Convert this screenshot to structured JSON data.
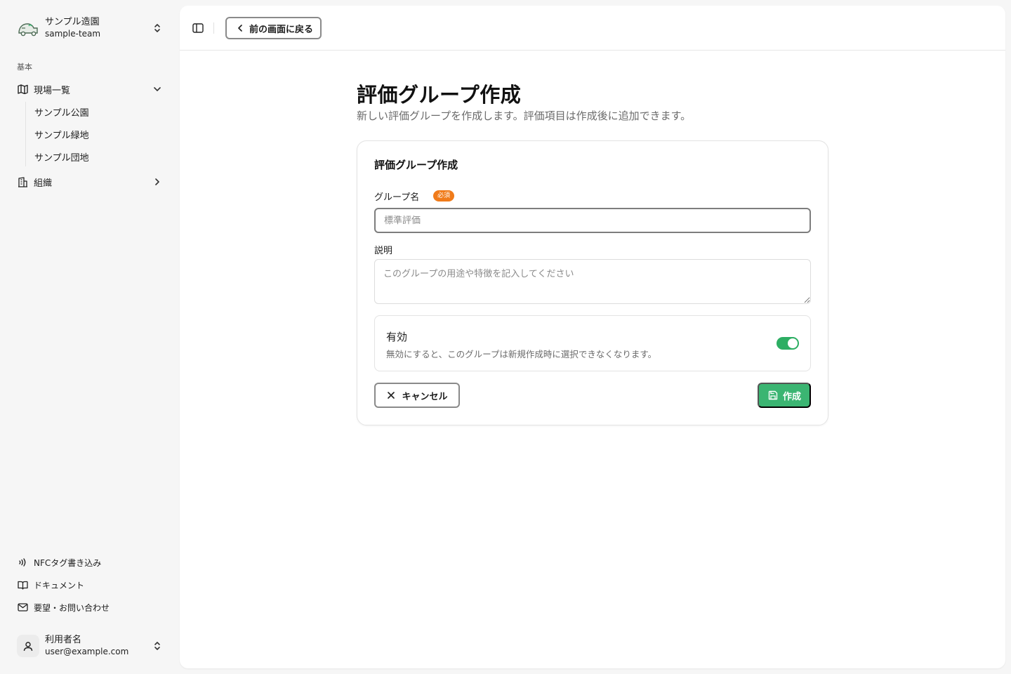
{
  "team": {
    "name": "サンプル造園",
    "slug": "sample-team",
    "logo_icon": "truck-logo-icon"
  },
  "sidebar": {
    "group_label": "基本",
    "sites": {
      "label": "現場一覧",
      "icon": "map-icon",
      "expanded": true,
      "children": [
        "サンプル公園",
        "サンプル緑地",
        "サンプル団地"
      ]
    },
    "org": {
      "label": "組織",
      "icon": "building-icon",
      "expanded": false
    },
    "footer": [
      {
        "label": "NFCタグ書き込み",
        "icon": "nfc-icon"
      },
      {
        "label": "ドキュメント",
        "icon": "book-icon"
      },
      {
        "label": "要望・お問い合わせ",
        "icon": "mail-icon"
      }
    ]
  },
  "user": {
    "name": "利用者名",
    "email": "user@example.com"
  },
  "topbar": {
    "back_label": "前の画面に戻る"
  },
  "page": {
    "title": "評価グループ作成",
    "subtitle": "新しい評価グループを作成します。評価項目は作成後に追加できます。"
  },
  "form": {
    "card_title": "評価グループ作成",
    "name_label": "グループ名",
    "required_badge": "必須",
    "name_placeholder": "標準評価",
    "desc_label": "説明",
    "desc_placeholder": "このグループの用途や特徴を記入してください",
    "active_title": "有効",
    "active_desc": "無効にすると、このグループは新規作成時に選択できなくなります。",
    "active": true,
    "cancel_label": "キャンセル",
    "create_label": "作成"
  },
  "colors": {
    "accent": "#3bb572",
    "toggle_on": "#2dae63",
    "badge": "#f07b1a"
  }
}
